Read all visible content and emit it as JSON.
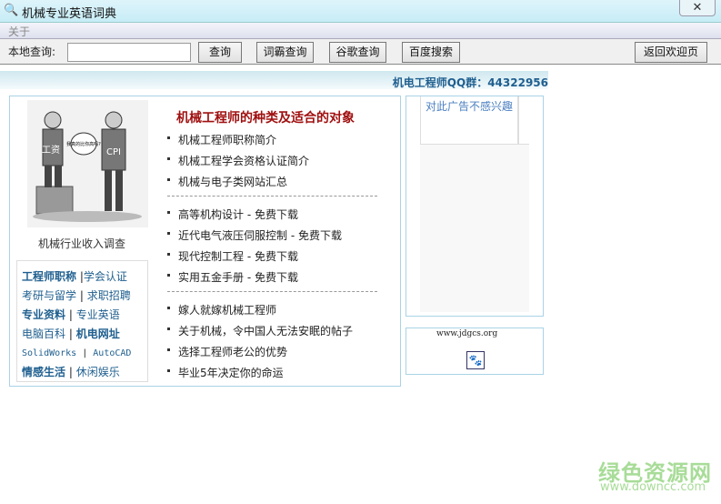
{
  "window": {
    "title": "机械专业英语词典",
    "close": "✕"
  },
  "menu": {
    "about": "关于"
  },
  "toolbar": {
    "search_label": "本地查询:",
    "search_value": "",
    "query": "查询",
    "ciba": "词霸查询",
    "google": "谷歌查询",
    "baidu": "百度搜索",
    "back": "返回欢迎页"
  },
  "banner": {
    "qq_group": "机电工程师QQ群：44322956"
  },
  "left": {
    "image": {
      "salary_label": "工资",
      "cpi_label": "CPI",
      "bubble": "我真的比你高吗?"
    },
    "caption": "机械行业收入调查",
    "links": [
      [
        "工程师职称",
        "学会认证"
      ],
      [
        "考研与留学",
        "求职招聘"
      ],
      [
        "专业资料",
        "专业英语"
      ],
      [
        "电脑百科",
        "机电网址"
      ],
      [
        "SolidWorks",
        "AutoCAD"
      ],
      [
        "情感生活",
        "休闲娱乐"
      ]
    ]
  },
  "main": {
    "heading": "机械工程师的种类及适合的对象",
    "group1": [
      "机械工程师职称简介",
      "机械工程学会资格认证简介",
      "机械与电子类网站汇总"
    ],
    "group2": [
      "高等机构设计 - 免费下载",
      "近代电气液压伺服控制 - 免费下载",
      "现代控制工程 - 免费下载",
      "实用五金手册 - 免费下载"
    ],
    "group3": [
      "嫁人就嫁机械工程师",
      "关于机械，令中国人无法安眠的帖子",
      "选择工程师老公的优势",
      "毕业5年决定你的命运"
    ]
  },
  "ad": {
    "not_interested": "对此广告不感兴趣"
  },
  "site": {
    "url": "www.jdgcs.org"
  },
  "watermark": {
    "name": "绿色资源网",
    "url": "www.downcc.com"
  },
  "colors": {
    "link": "#1f5f8f",
    "heading": "#a01010",
    "border": "#a9d3e6"
  }
}
